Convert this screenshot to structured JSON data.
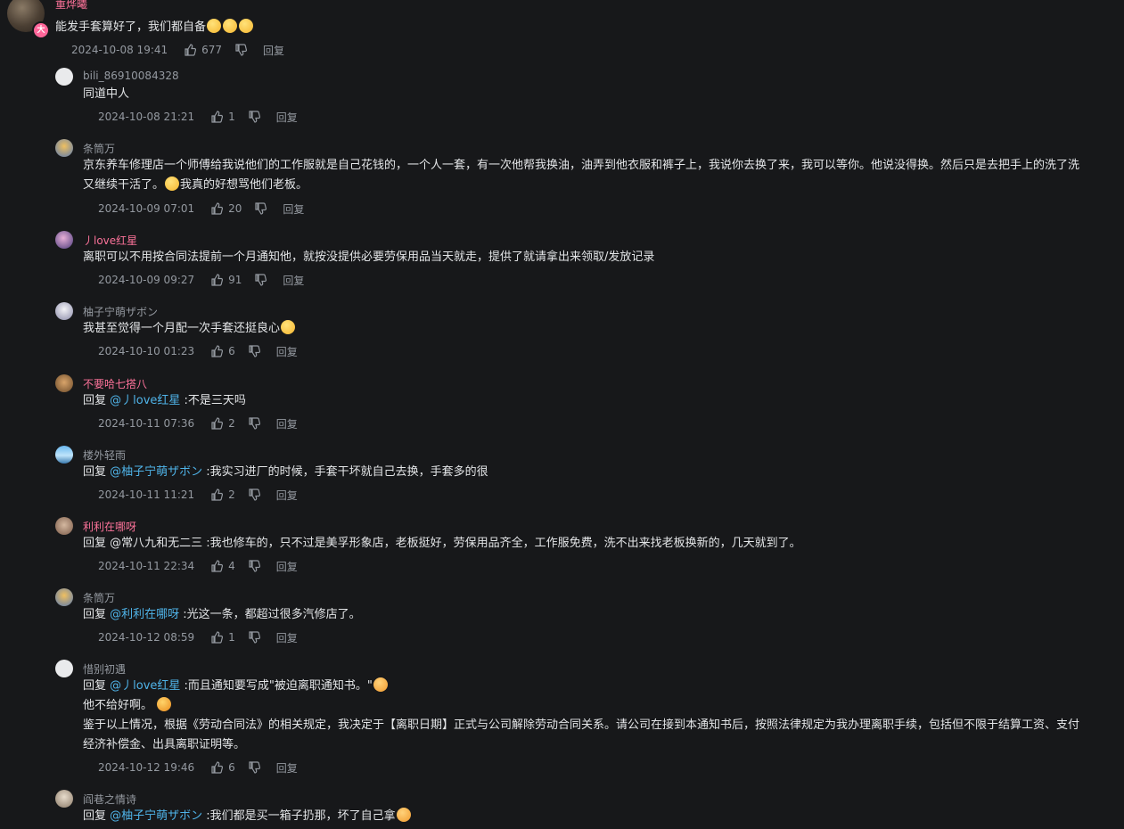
{
  "top": {
    "username": "重烨曦",
    "badge": "大",
    "text": "能发手套算好了，我们都自备",
    "time": "2024-10-08 19:41",
    "likes": "677",
    "reply_label": "回复"
  },
  "replies": [
    {
      "username": "bili_86910084328",
      "text": "同道中人",
      "time": "2024-10-08 21:21",
      "likes": "1",
      "reply_label": "回复"
    },
    {
      "username": "条筒万",
      "text_line1": "京东养车修理店一个师傅给我说他们的工作服就是自己花钱的，一个人一套，有一次他帮我换油，油弄到他衣服和裤子上，我说你去换了来，我可以等你。他说没得换。然后只是去把手上的洗了洗",
      "text_line2_a": "又继续干活了。",
      "text_line2_b": "我真的好想骂他们老板。",
      "time": "2024-10-09 07:01",
      "likes": "20",
      "reply_label": "回复"
    },
    {
      "username": "丿love红星",
      "text": "离职可以不用按合同法提前一个月通知他，就按没提供必要劳保用品当天就走，提供了就请拿出来领取/发放记录",
      "time": "2024-10-09 09:27",
      "likes": "91",
      "reply_label": "回复"
    },
    {
      "username": "柚子宁萌ザボン",
      "text": "我甚至觉得一个月配一次手套还挺良心",
      "time": "2024-10-10 01:23",
      "likes": "6",
      "reply_label": "回复"
    },
    {
      "username": "不要哈七搭八",
      "prefix": "回复 ",
      "at": "@丿love红星",
      "text": " :不是三天吗",
      "time": "2024-10-11 07:36",
      "likes": "2",
      "reply_label": "回复"
    },
    {
      "username": "楼外轻雨",
      "prefix": "回复 ",
      "at": "@柚子宁萌ザボン",
      "text": " :我实习进厂的时候，手套干坏就自己去换，手套多的很",
      "time": "2024-10-11 11:21",
      "likes": "2",
      "reply_label": "回复"
    },
    {
      "username": "利利在哪呀",
      "prefix": "回复 ",
      "text": "@常八九和无二三 :我也修车的，只不过是美孚形象店，老板挺好，劳保用品齐全，工作服免费，洗不出来找老板换新的，几天就到了。",
      "time": "2024-10-11 22:34",
      "likes": "4",
      "reply_label": "回复"
    },
    {
      "username": "条筒万",
      "prefix": "回复 ",
      "at": "@利利在哪呀",
      "text": " :光这一条，都超过很多汽修店了。",
      "time": "2024-10-12 08:59",
      "likes": "1",
      "reply_label": "回复"
    },
    {
      "username": "惜别初遇",
      "prefix": "回复 ",
      "at": "@丿love红星",
      "text": " :而且通知要写成\"被迫离职通知书。\"",
      "line2": "他不给好啊。",
      "line3": "鉴于以上情况，根据《劳动合同法》的相关规定，我决定于【离职日期】正式与公司解除劳动合同关系。请公司在接到本通知书后，按照法律规定为我办理离职手续，包括但不限于结算工资、支付",
      "line4": "经济补偿金、出具离职证明等。",
      "time": "2024-10-12 19:46",
      "likes": "6",
      "reply_label": "回复"
    },
    {
      "username": "阎巷之情诗",
      "prefix": "回复 ",
      "at": "@柚子宁萌ザボン",
      "text": " :我们都是买一箱子扔那，坏了自己拿"
    }
  ]
}
